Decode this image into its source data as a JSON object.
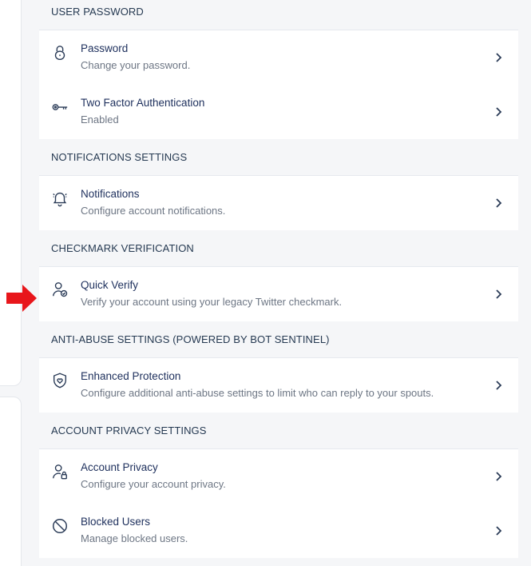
{
  "sections": [
    {
      "header": "USER PASSWORD",
      "items": [
        {
          "title": "Password",
          "subtitle": "Change your password.",
          "icon": "lock-icon"
        },
        {
          "title": "Two Factor Authentication",
          "subtitle": "Enabled",
          "icon": "key-icon"
        }
      ]
    },
    {
      "header": "NOTIFICATIONS SETTINGS",
      "items": [
        {
          "title": "Notifications",
          "subtitle": "Configure account notifications.",
          "icon": "bell-icon"
        }
      ]
    },
    {
      "header": "CHECKMARK VERIFICATION",
      "items": [
        {
          "title": "Quick Verify",
          "subtitle": "Verify your account using your legacy Twitter checkmark.",
          "icon": "user-check-icon"
        }
      ]
    },
    {
      "header": "ANTI-ABUSE SETTINGS (POWERED BY BOT SENTINEL)",
      "items": [
        {
          "title": "Enhanced Protection",
          "subtitle": "Configure additional anti-abuse settings to limit who can reply to your spouts.",
          "icon": "shield-heart-icon"
        }
      ]
    },
    {
      "header": "ACCOUNT PRIVACY SETTINGS",
      "items": [
        {
          "title": "Account Privacy",
          "subtitle": "Configure your account privacy.",
          "icon": "user-lock-icon"
        },
        {
          "title": "Blocked Users",
          "subtitle": "Manage blocked users.",
          "icon": "block-icon"
        }
      ]
    }
  ],
  "colors": {
    "annotation_arrow": "#e8161b",
    "title_text": "#1d2f5c",
    "subtitle_text": "#6d7684"
  }
}
